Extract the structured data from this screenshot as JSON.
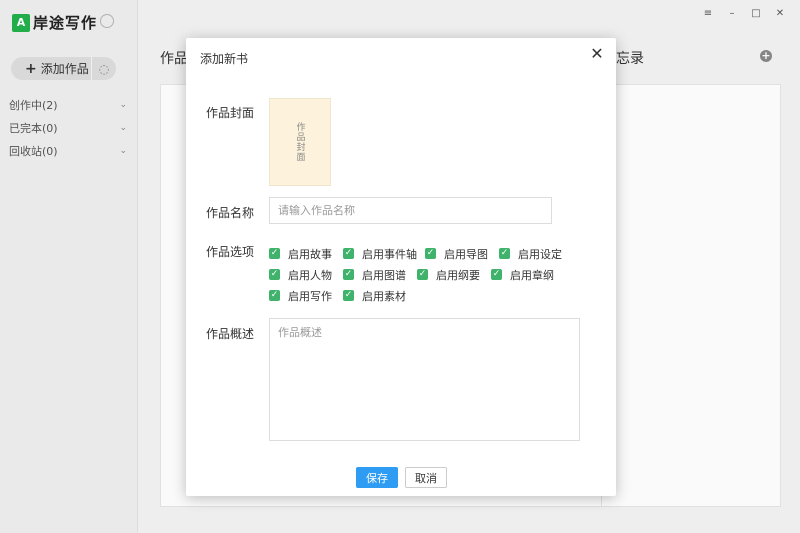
{
  "app": {
    "title": "岸途写作",
    "logo_letter": "A"
  },
  "sidebar": {
    "add_work_label": "添加作品",
    "add_icon": "+",
    "refresh_icon": "◌",
    "items": [
      {
        "label": "创作中",
        "count": "(2)"
      },
      {
        "label": "已完本",
        "count": "(0)"
      },
      {
        "label": "回收站",
        "count": "(0)"
      }
    ],
    "chevron": "⌄"
  },
  "main": {
    "works_title": "作品",
    "memo_title": "忘录",
    "memo_add_icon": "+"
  },
  "window": {
    "menu_icon": "≡",
    "min_icon": "–",
    "max_icon": "□",
    "close_icon": "✕"
  },
  "modal": {
    "title": "添加新书",
    "close_icon": "✕",
    "cover_label": "作品封面",
    "cover_text": "作品封面",
    "name_label": "作品名称",
    "name_placeholder": "请输入作品名称",
    "name_value": "",
    "options_label": "作品选项",
    "options": [
      [
        "启用故事",
        "启用事件轴",
        "启用导图",
        "启用设定"
      ],
      [
        "启用人物",
        "启用图谱",
        "启用纲要",
        "启用章纲"
      ],
      [
        "启用写作",
        "启用素材"
      ]
    ],
    "check_glyph": "✓",
    "desc_label": "作品概述",
    "desc_placeholder": "作品概述",
    "save_label": "保存",
    "cancel_label": "取消"
  }
}
